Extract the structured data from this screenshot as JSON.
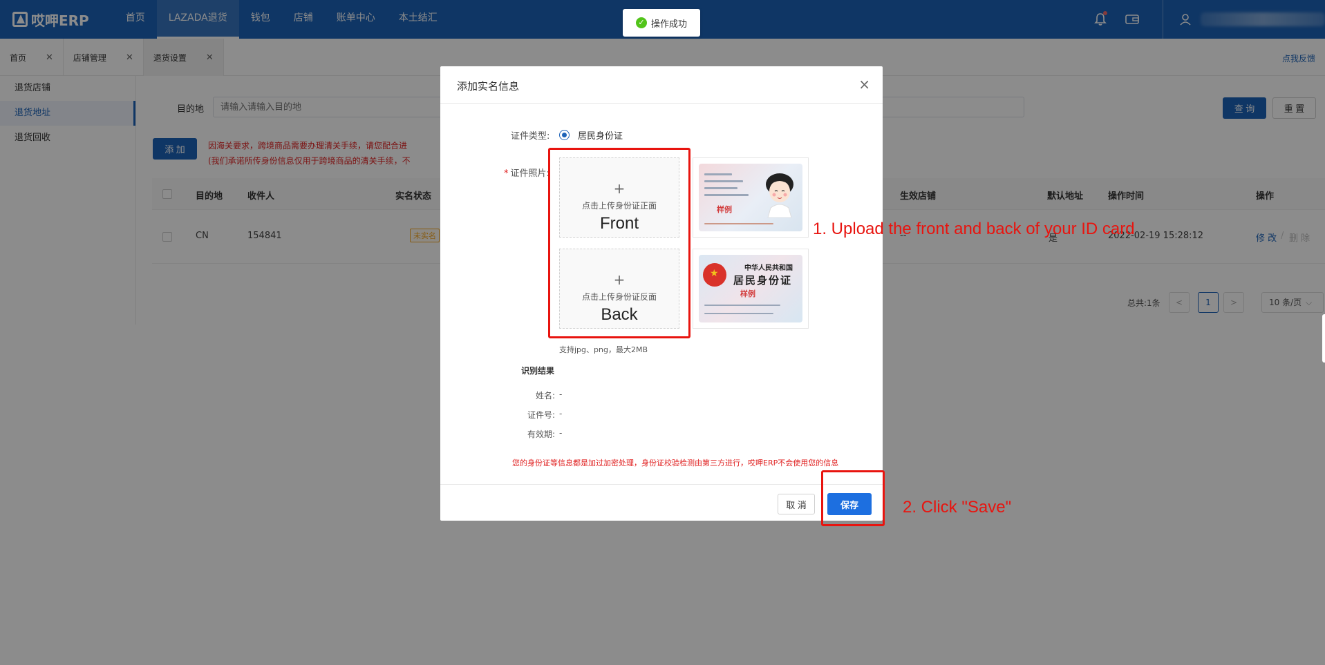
{
  "app": {
    "logo": "哎呷ERP"
  },
  "topnav": {
    "items": [
      "首页",
      "LAZADA退货",
      "钱包",
      "店铺",
      "账单中心",
      "本土结汇"
    ],
    "active_index": 1
  },
  "toast": {
    "message": "操作成功"
  },
  "tabs": {
    "items": [
      "首页",
      "店铺管理",
      "退货设置"
    ],
    "feedback": "点我反馈"
  },
  "sidebar": {
    "items": [
      "退货店铺",
      "退货地址",
      "退货回收"
    ],
    "active_index": 1
  },
  "filter": {
    "dest_label": "目的地",
    "dest_placeholder": "请输入请输入目的地",
    "query_label": "查 询",
    "reset_label": "重 置"
  },
  "toolbar": {
    "add_label": "添 加",
    "notice_line1": "因海关要求，跨境商品需要办理清关手续，请您配合进",
    "notice_line2": "(我们承诺所传身份信息仅用于跨境商品的清关手续，不"
  },
  "table": {
    "headers": [
      "目的地",
      "收件人",
      "实名状态",
      "生效店铺",
      "默认地址",
      "操作时间",
      "操作"
    ],
    "rows": [
      {
        "dest": "CN",
        "recipient": "154841",
        "status": "未实名",
        "shop": "--",
        "default": "是",
        "time": "2022-02-19 15:28:12",
        "edit": "修 改",
        "delete": "删 除"
      }
    ]
  },
  "pagination": {
    "total": "总共:1条",
    "prev": "<",
    "current": "1",
    "next": ">",
    "page_size": "10 条/页"
  },
  "modal": {
    "title": "添加实名信息",
    "close": "×",
    "id_type_label": "证件类型:",
    "id_type_value": "居民身份证",
    "photo_label": "证件照片:",
    "front_text": "点击上传身份证正面",
    "front_caption": "Front",
    "back_text": "点击上传身份证反面",
    "back_caption": "Back",
    "plus": "+",
    "sample_front_stamp": "样例",
    "sample_back_stamp": "样例",
    "sample_back_title1": "中华人民共和国",
    "sample_back_title2": "居民身份证",
    "hint": "支持jpg、png，最大2MB",
    "result_title": "识别结果",
    "name_label": "姓名:",
    "name_value": "-",
    "id_label": "证件号:",
    "id_value": "-",
    "valid_label": "有效期:",
    "valid_value": "-",
    "security_note": "您的身份证等信息都是加过加密处理，身份证校验检测由第三方进行，哎呷ERP不会使用您的信息",
    "cancel_label": "取 消",
    "save_label": "保存"
  },
  "annotations": {
    "step1": "1. Upload the front and back of your ID card",
    "step2": "2. Click \"Save\""
  },
  "colors": {
    "brand": "#1d63b8",
    "annotation": "#e8140f",
    "success": "#52c41a"
  }
}
